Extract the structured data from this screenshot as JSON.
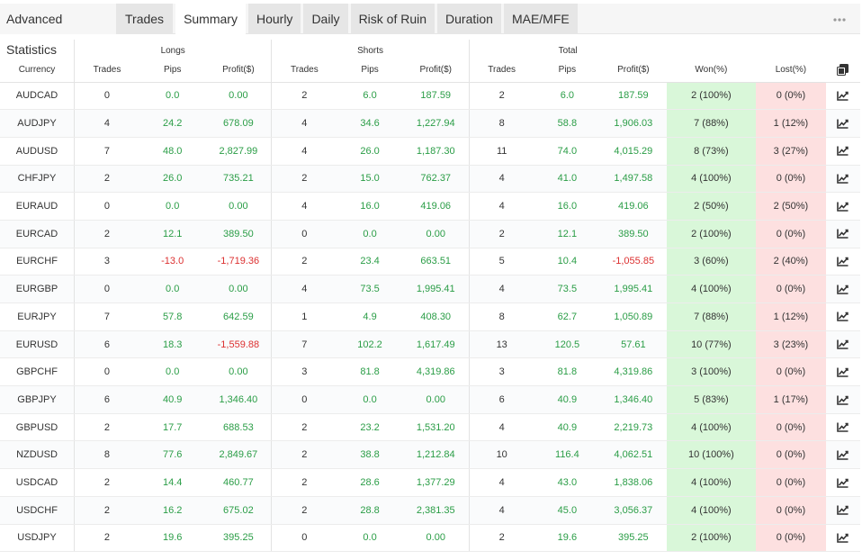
{
  "header": {
    "title": "Advanced Statistics",
    "tabs": [
      {
        "label": "Trades",
        "active": false
      },
      {
        "label": "Summary",
        "active": true
      },
      {
        "label": "Hourly",
        "active": false
      },
      {
        "label": "Daily",
        "active": false
      },
      {
        "label": "Risk of Ruin",
        "active": false
      },
      {
        "label": "Duration",
        "active": false
      },
      {
        "label": "MAE/MFE",
        "active": false
      }
    ]
  },
  "table": {
    "groups": {
      "longs": "Longs",
      "shorts": "Shorts",
      "total": "Total"
    },
    "columns": {
      "currency": "Currency",
      "long_trades": "Trades",
      "long_pips": "Pips",
      "long_profit": "Profit($)",
      "short_trades": "Trades",
      "short_pips": "Pips",
      "short_profit": "Profit($)",
      "total_trades": "Trades",
      "total_pips": "Pips",
      "total_profit": "Profit($)",
      "won": "Won(%)",
      "lost": "Lost(%)"
    },
    "rows": [
      {
        "currency": "AUDCAD",
        "lt": "0",
        "lp": "0.0",
        "lpr": "0.00",
        "st": "2",
        "sp": "6.0",
        "spr": "187.59",
        "tt": "2",
        "tp": "6.0",
        "tpr": "187.59",
        "won": "2 (100%)",
        "lost": "0 (0%)"
      },
      {
        "currency": "AUDJPY",
        "lt": "4",
        "lp": "24.2",
        "lpr": "678.09",
        "st": "4",
        "sp": "34.6",
        "spr": "1,227.94",
        "tt": "8",
        "tp": "58.8",
        "tpr": "1,906.03",
        "won": "7 (88%)",
        "lost": "1 (12%)"
      },
      {
        "currency": "AUDUSD",
        "lt": "7",
        "lp": "48.0",
        "lpr": "2,827.99",
        "st": "4",
        "sp": "26.0",
        "spr": "1,187.30",
        "tt": "11",
        "tp": "74.0",
        "tpr": "4,015.29",
        "won": "8 (73%)",
        "lost": "3 (27%)"
      },
      {
        "currency": "CHFJPY",
        "lt": "2",
        "lp": "26.0",
        "lpr": "735.21",
        "st": "2",
        "sp": "15.0",
        "spr": "762.37",
        "tt": "4",
        "tp": "41.0",
        "tpr": "1,497.58",
        "won": "4 (100%)",
        "lost": "0 (0%)"
      },
      {
        "currency": "EURAUD",
        "lt": "0",
        "lp": "0.0",
        "lpr": "0.00",
        "st": "4",
        "sp": "16.0",
        "spr": "419.06",
        "tt": "4",
        "tp": "16.0",
        "tpr": "419.06",
        "won": "2 (50%)",
        "lost": "2 (50%)"
      },
      {
        "currency": "EURCAD",
        "lt": "2",
        "lp": "12.1",
        "lpr": "389.50",
        "st": "0",
        "sp": "0.0",
        "spr": "0.00",
        "tt": "2",
        "tp": "12.1",
        "tpr": "389.50",
        "won": "2 (100%)",
        "lost": "0 (0%)"
      },
      {
        "currency": "EURCHF",
        "lt": "3",
        "lp": "-13.0",
        "lpr": "-1,719.36",
        "st": "2",
        "sp": "23.4",
        "spr": "663.51",
        "tt": "5",
        "tp": "10.4",
        "tpr": "-1,055.85",
        "won": "3 (60%)",
        "lost": "2 (40%)"
      },
      {
        "currency": "EURGBP",
        "lt": "0",
        "lp": "0.0",
        "lpr": "0.00",
        "st": "4",
        "sp": "73.5",
        "spr": "1,995.41",
        "tt": "4",
        "tp": "73.5",
        "tpr": "1,995.41",
        "won": "4 (100%)",
        "lost": "0 (0%)"
      },
      {
        "currency": "EURJPY",
        "lt": "7",
        "lp": "57.8",
        "lpr": "642.59",
        "st": "1",
        "sp": "4.9",
        "spr": "408.30",
        "tt": "8",
        "tp": "62.7",
        "tpr": "1,050.89",
        "won": "7 (88%)",
        "lost": "1 (12%)"
      },
      {
        "currency": "EURUSD",
        "lt": "6",
        "lp": "18.3",
        "lpr": "-1,559.88",
        "st": "7",
        "sp": "102.2",
        "spr": "1,617.49",
        "tt": "13",
        "tp": "120.5",
        "tpr": "57.61",
        "won": "10 (77%)",
        "lost": "3 (23%)"
      },
      {
        "currency": "GBPCHF",
        "lt": "0",
        "lp": "0.0",
        "lpr": "0.00",
        "st": "3",
        "sp": "81.8",
        "spr": "4,319.86",
        "tt": "3",
        "tp": "81.8",
        "tpr": "4,319.86",
        "won": "3 (100%)",
        "lost": "0 (0%)"
      },
      {
        "currency": "GBPJPY",
        "lt": "6",
        "lp": "40.9",
        "lpr": "1,346.40",
        "st": "0",
        "sp": "0.0",
        "spr": "0.00",
        "tt": "6",
        "tp": "40.9",
        "tpr": "1,346.40",
        "won": "5 (83%)",
        "lost": "1 (17%)"
      },
      {
        "currency": "GBPUSD",
        "lt": "2",
        "lp": "17.7",
        "lpr": "688.53",
        "st": "2",
        "sp": "23.2",
        "spr": "1,531.20",
        "tt": "4",
        "tp": "40.9",
        "tpr": "2,219.73",
        "won": "4 (100%)",
        "lost": "0 (0%)"
      },
      {
        "currency": "NZDUSD",
        "lt": "8",
        "lp": "77.6",
        "lpr": "2,849.67",
        "st": "2",
        "sp": "38.8",
        "spr": "1,212.84",
        "tt": "10",
        "tp": "116.4",
        "tpr": "4,062.51",
        "won": "10 (100%)",
        "lost": "0 (0%)"
      },
      {
        "currency": "USDCAD",
        "lt": "2",
        "lp": "14.4",
        "lpr": "460.77",
        "st": "2",
        "sp": "28.6",
        "spr": "1,377.29",
        "tt": "4",
        "tp": "43.0",
        "tpr": "1,838.06",
        "won": "4 (100%)",
        "lost": "0 (0%)"
      },
      {
        "currency": "USDCHF",
        "lt": "2",
        "lp": "16.2",
        "lpr": "675.02",
        "st": "2",
        "sp": "28.8",
        "spr": "2,381.35",
        "tt": "4",
        "tp": "45.0",
        "tpr": "3,056.37",
        "won": "4 (100%)",
        "lost": "0 (0%)"
      },
      {
        "currency": "USDJPY",
        "lt": "2",
        "lp": "19.6",
        "lpr": "395.25",
        "st": "0",
        "sp": "0.0",
        "spr": "0.00",
        "tt": "2",
        "tp": "19.6",
        "tpr": "395.25",
        "won": "2 (100%)",
        "lost": "0 (0%)"
      }
    ]
  },
  "icons": {
    "more": "more-dots-icon",
    "copy": "copy-icon",
    "row_action": "line-chart-icon"
  },
  "colors": {
    "positive": "#2a9d46",
    "negative": "#dc3030",
    "won_bg": "#d9f7d9",
    "lost_bg": "#fde0e0"
  }
}
